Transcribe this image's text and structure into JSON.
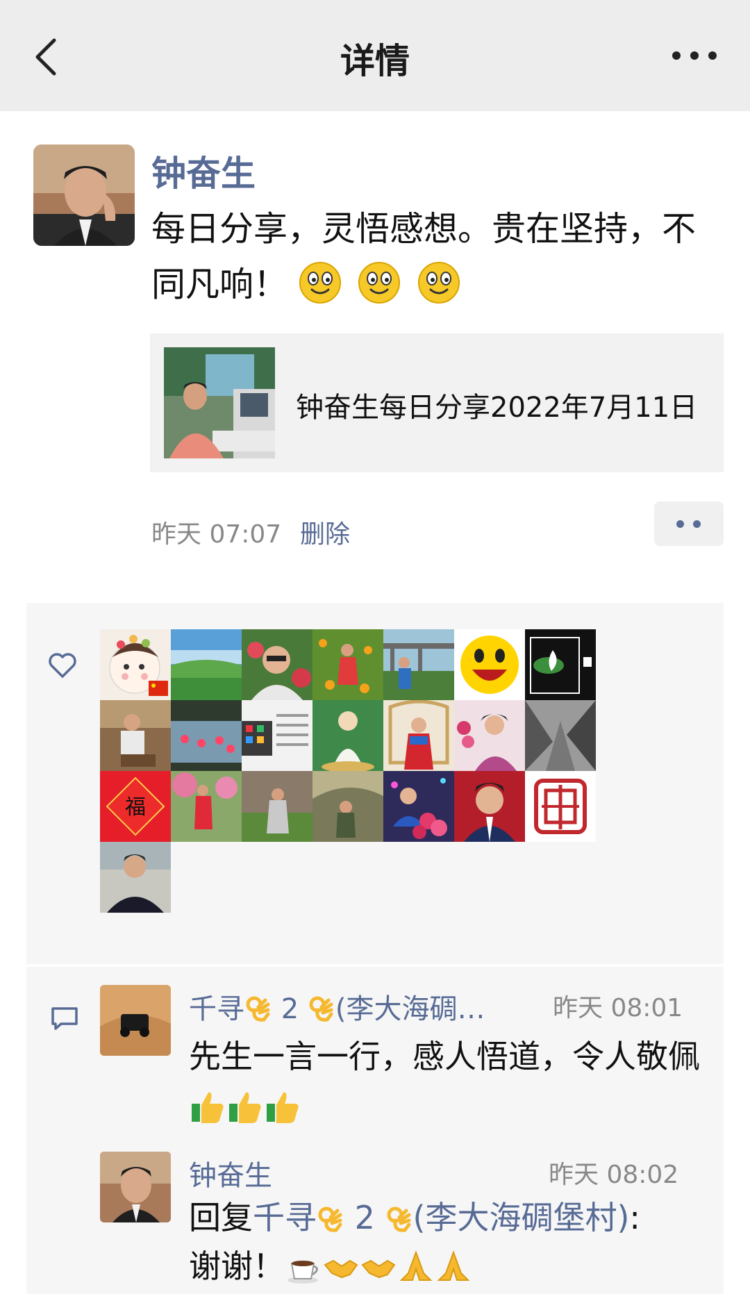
{
  "header": {
    "title": "详情"
  },
  "post": {
    "author": "钟奋生",
    "text": "每日分享，灵悟感想。贵在坚持，不同凡响！",
    "emoji_count": 3,
    "link_title": "钟奋生每日分享2022年7月11日",
    "time": "昨天 07:07",
    "delete_label": "删除"
  },
  "likes": {
    "count": 22,
    "icon": "heart-icon"
  },
  "comments": [
    {
      "name_prefix": "千寻",
      "name_mid": " 2 ",
      "name_suffix": "(李大海碉…",
      "time": "昨天 08:01",
      "text": "先生一言一行，感人悟道，令人敬佩"
    },
    {
      "name": "钟奋生",
      "time": "昨天 08:02",
      "reply_label": "回复",
      "reply_to_prefix": "千寻",
      "reply_to_mid": " 2 ",
      "reply_to_suffix": "(李大海碉堡村)",
      "colon": ":",
      "text": "谢谢！"
    }
  ],
  "colors": {
    "link_blue": "#576b95",
    "topbar_bg": "#ededed",
    "panel_bg": "#f6f6f6"
  }
}
